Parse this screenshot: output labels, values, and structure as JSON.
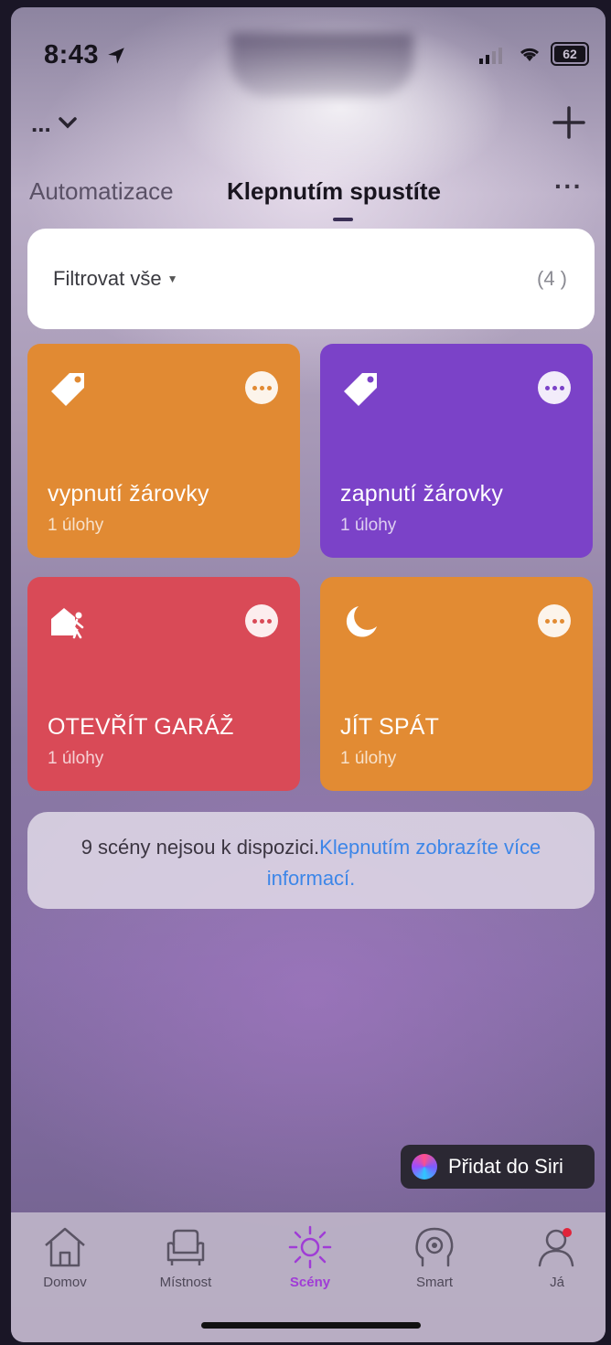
{
  "status_bar": {
    "time": "8:43",
    "battery": "62"
  },
  "header": {
    "home_name": "...",
    "add_icon": "plus-icon"
  },
  "tabs": {
    "automation": "Automatizace",
    "tap_to_run": "Klepnutím spustíte",
    "more": "···"
  },
  "filter": {
    "label": "Filtrovat vše",
    "count": "(4 )"
  },
  "scenes": [
    {
      "name": "vypnutí žárovky",
      "tasks": "1 úlohy",
      "icon": "tag-icon",
      "color": "#e18a33"
    },
    {
      "name": "zapnutí žárovky",
      "tasks": "1 úlohy",
      "icon": "tag-icon",
      "color": "#7b42c8"
    },
    {
      "name": "OTEVŘÍT GARÁŽ",
      "tasks": "1 úlohy",
      "icon": "home-leave-icon",
      "color": "#d94a57"
    },
    {
      "name": "JÍT SPÁT",
      "tasks": "1 úlohy",
      "icon": "moon-icon",
      "color": "#e28b33"
    }
  ],
  "info": {
    "text": "9 scény nejsou k dispozici.",
    "link": "Klepnutím zobrazíte více informací."
  },
  "siri": {
    "label": "Přidat do Siri"
  },
  "nav": [
    {
      "label": "Domov",
      "icon": "home-icon"
    },
    {
      "label": "Místnost",
      "icon": "armchair-icon"
    },
    {
      "label": "Scény",
      "icon": "sun-icon",
      "active": true
    },
    {
      "label": "Smart",
      "icon": "smart-head-icon"
    },
    {
      "label": "Já",
      "icon": "profile-icon"
    }
  ],
  "colors": {
    "accent": "#a03cd6",
    "link": "#3d86e8"
  }
}
